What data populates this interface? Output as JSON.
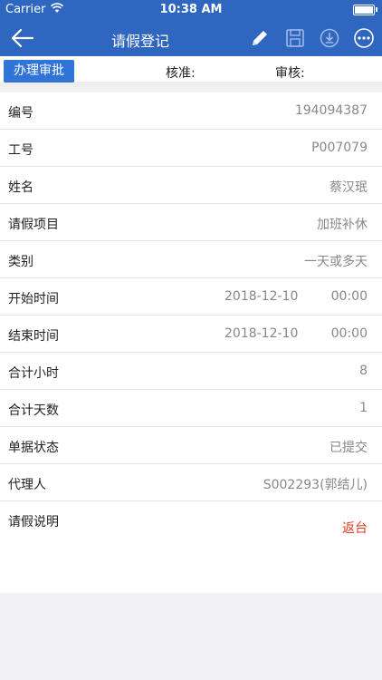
{
  "status_bar": {
    "carrier": "Carrier",
    "time": "10:38 AM"
  },
  "nav": {
    "title": "请假登记",
    "icons": [
      "back-arrow-icon",
      "edit-pencil-icon",
      "save-disk-icon",
      "download-icon",
      "more-icon"
    ]
  },
  "approval": {
    "button_label": "办理审批",
    "approve_label": "核准:",
    "review_label": "审核:"
  },
  "form": {
    "rows": [
      {
        "label": "编号",
        "value": "194094387"
      },
      {
        "label": "工号",
        "value": "P007079"
      },
      {
        "label": "姓名",
        "value": "蔡汉珉"
      },
      {
        "label": "请假项目",
        "value": "加班补休"
      },
      {
        "label": "类别",
        "value": "一天或多天"
      },
      {
        "label": "开始时间",
        "date": "2018-12-10",
        "time": "00:00"
      },
      {
        "label": "结束时间",
        "date": "2018-12-10",
        "time": "00:00"
      },
      {
        "label": "合计小时",
        "value": "8"
      },
      {
        "label": "合计天数",
        "value": "1"
      },
      {
        "label": "单据状态",
        "value": "已提交"
      },
      {
        "label": "代理人",
        "value": "S002293(郭结儿)"
      }
    ],
    "remark": {
      "label": "请假说明",
      "return_label": "返台"
    }
  },
  "colors": {
    "primary": "#2f66c0",
    "accent_button": "#2f74d6",
    "return_red": "#e23a1f"
  }
}
